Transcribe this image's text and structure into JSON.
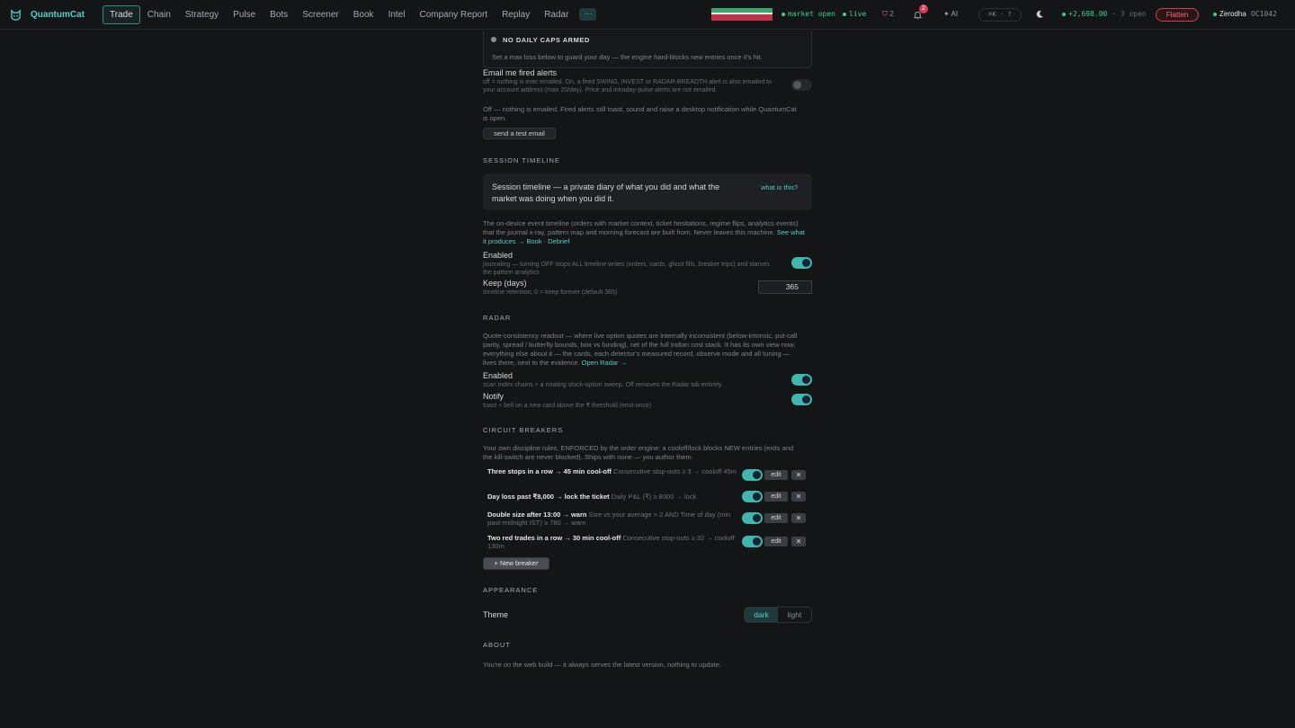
{
  "app": {
    "name": "QuantumCat"
  },
  "nav": {
    "items": [
      "Trade",
      "Chain",
      "Strategy",
      "Pulse",
      "Bots",
      "Screener",
      "Book",
      "Intel",
      "Company Report",
      "Replay",
      "Radar"
    ],
    "more": "···"
  },
  "status": {
    "market": "market open",
    "live": "live",
    "flags": "2",
    "notifications": "2",
    "ai": "✦ AI",
    "shortcut": "⌘K · ?",
    "pnl": "+2,698.00",
    "open": "3 open",
    "flatten": "Flatten",
    "broker": "Zerodha",
    "account": "OC1042"
  },
  "caps": {
    "title": "NO DAILY CAPS ARMED",
    "desc": "Set a max loss below to guard your day — the engine hard-blocks new entries once it's hit."
  },
  "email": {
    "label": "Email me fired alerts",
    "sub": "off = nothing is ever emailed. On, a fired SWING, INVEST or RADAR-BREADTH alert is also emailed to your account address (max 20/day). Price and intraday-pulse alerts are not emailed.",
    "note": "Off — nothing is emailed. Fired alerts still toast, sound and raise a desktop notification while QuantumCat is open.",
    "test_button": "send a test email"
  },
  "timeline": {
    "section": "SESSION TIMELINE",
    "info": "Session timeline — a private diary of what you did and what the market was doing when you did it.",
    "info_link": "what is this?",
    "desc": "The on-device event timeline (orders with market context, ticket hesitations, regime flips, analytics events) that the journal x-ray, pattern map and morning forecast are built from. Never leaves this machine.",
    "desc_link": "See what it produces → Book · Debrief",
    "enabled_label": "Enabled",
    "enabled_sub": "journaling — turning OFF stops ALL timeline writes (orders, cards, ghost fills, breaker trips) and starves the pattern analytics",
    "keep_label": "Keep (days)",
    "keep_sub": "timeline retention; 0 = keep forever (default 365)",
    "keep_value": "365"
  },
  "radar": {
    "section": "RADAR",
    "desc": "Quote-consistency readout — where live option quotes are internally inconsistent (below-intrinsic, put-call parity, spread / butterfly bounds, box vs funding), net of the full Indian cost stack. It has its own view now; everything else about it — the cards, each detector's measured record, observe mode and all tuning — lives there, next to the evidence.",
    "desc_link": "Open Radar →",
    "enabled_label": "Enabled",
    "enabled_sub": "scan index chains + a rotating stock-option sweep. Off removes the Radar tab entirely.",
    "notify_label": "Notify",
    "notify_sub": "toast + bell on a new card above the ₹ threshold (emit-once)"
  },
  "breakers": {
    "section": "CIRCUIT BREAKERS",
    "desc": "Your own discipline rules, ENFORCED by the order engine: a cooloff/lock blocks NEW entries (exits and the kill-switch are never blocked). Ships with none — you author them.",
    "rows": [
      {
        "title": "Three stops in a row → 45 min cool-off",
        "rule": "Consecutive stop-outs ≥ 3 → cooloff 45m"
      },
      {
        "title": "Day loss past ₹8,000 → lock the ticket",
        "rule": "Daily P&L (₹) ≥ 8000 → lock"
      },
      {
        "title": "Double size after 13:00 → warn",
        "rule": "Size vs your average > 2 AND Time of day (min past midnight IST) ≥ 780 → warn"
      },
      {
        "title": "Two red trades in a row → 30 min cool-off",
        "rule": "Consecutive stop-outs ≥ 32 → cooloff 130m"
      }
    ],
    "edit": "edit",
    "remove": "✕",
    "new_button": "+ New breaker"
  },
  "appearance": {
    "section": "APPEARANCE",
    "theme_label": "Theme",
    "dark": "dark",
    "light": "light"
  },
  "about": {
    "section": "ABOUT",
    "text": "You're on the web build — it always serves the latest version, nothing to update."
  }
}
